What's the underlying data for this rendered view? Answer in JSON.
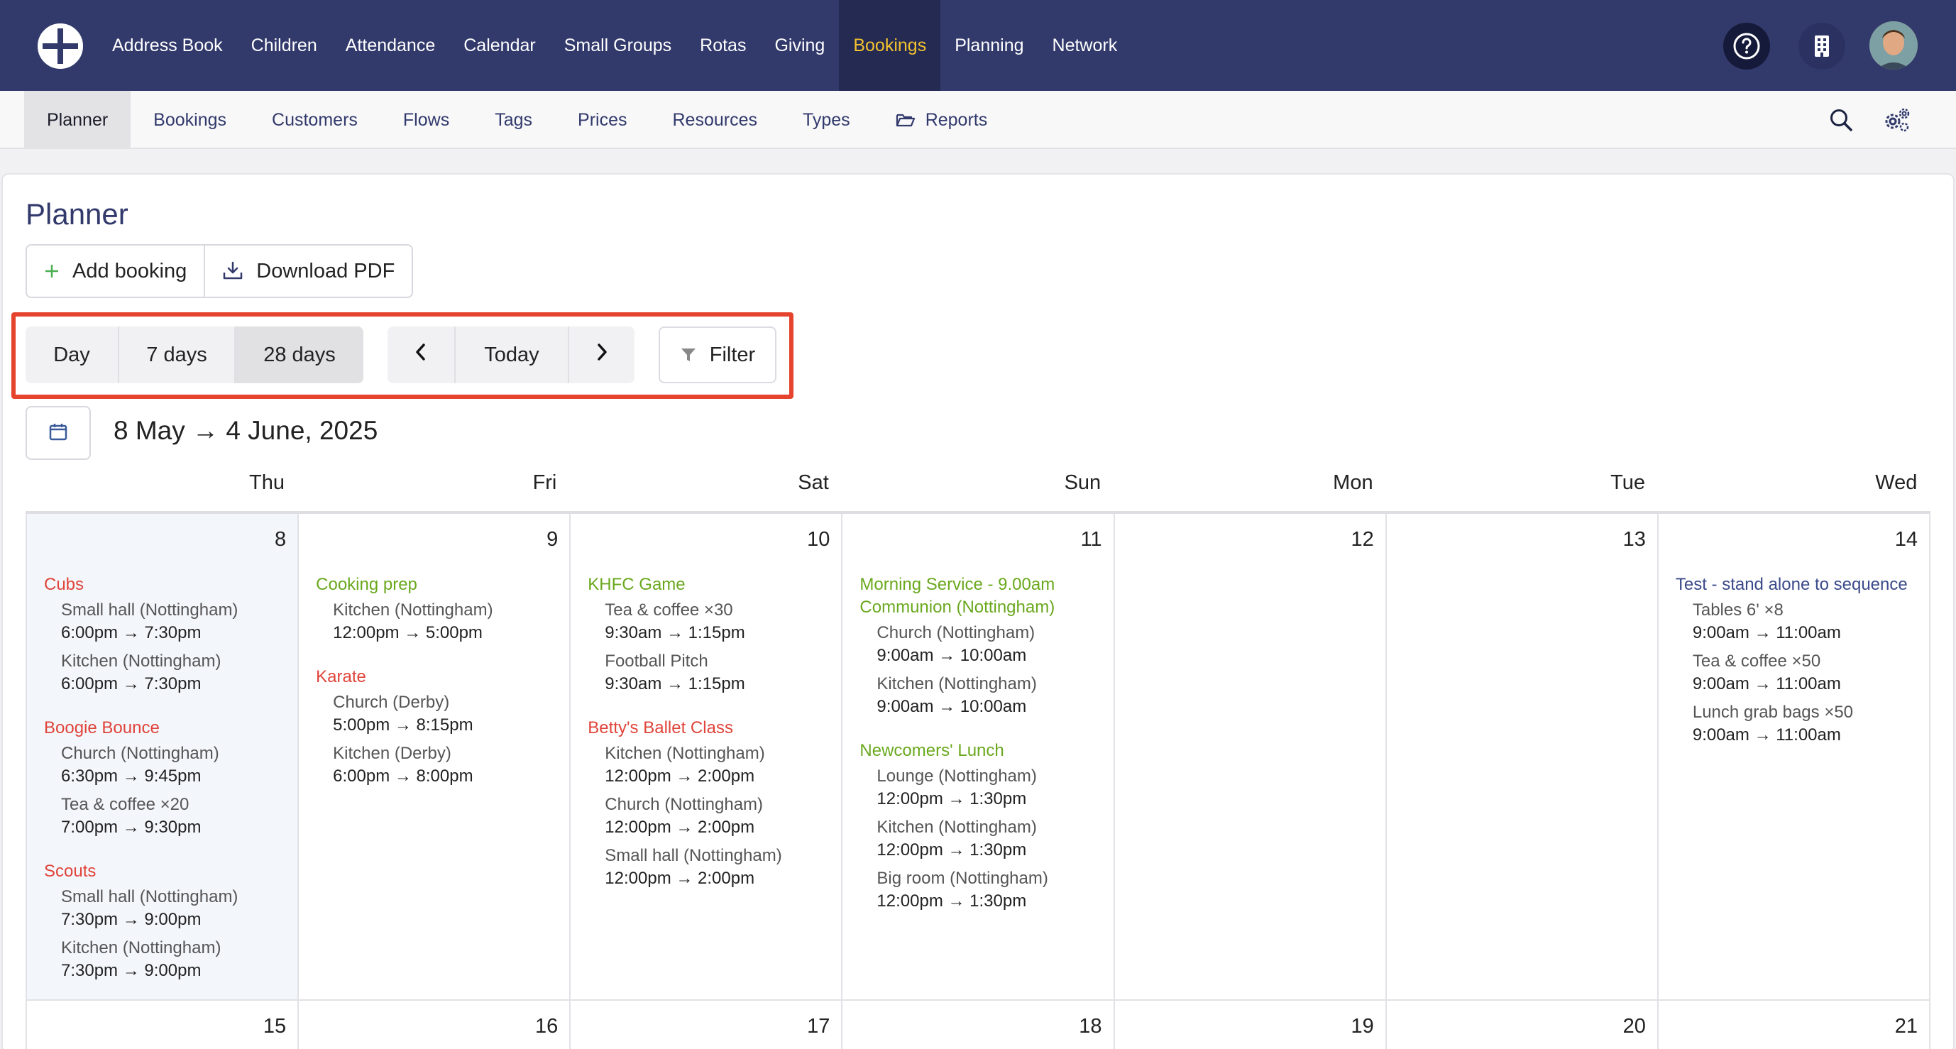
{
  "topnav": {
    "items": [
      "Address Book",
      "Children",
      "Attendance",
      "Calendar",
      "Small Groups",
      "Rotas",
      "Giving",
      "Bookings",
      "Planning",
      "Network"
    ],
    "active": "Bookings"
  },
  "subnav": {
    "items": [
      "Planner",
      "Bookings",
      "Customers",
      "Flows",
      "Tags",
      "Prices",
      "Resources",
      "Types",
      "Reports"
    ],
    "active": "Planner"
  },
  "page": {
    "title": "Planner",
    "add_booking": "Add booking",
    "download_pdf": "Download PDF"
  },
  "view_toggle": {
    "day": "Day",
    "seven": "7 days",
    "twenty_eight": "28 days",
    "active": "28 days"
  },
  "nav": {
    "prev": "‹",
    "today": "Today",
    "next": "›"
  },
  "filter": "Filter",
  "range": "8 May → 4 June, 2025",
  "weekdays": [
    "Thu",
    "Fri",
    "Sat",
    "Sun",
    "Mon",
    "Tue",
    "Wed"
  ],
  "week1": [
    {
      "num": "8",
      "events": [
        {
          "title": "Cubs",
          "color": "red",
          "resources": [
            {
              "name": "Small hall (Nottingham)",
              "time": "6:00pm → 7:30pm"
            },
            {
              "name": "Kitchen (Nottingham)",
              "time": "6:00pm → 7:30pm"
            }
          ]
        },
        {
          "title": "Boogie Bounce",
          "color": "red",
          "resources": [
            {
              "name": "Church (Nottingham)",
              "time": "6:30pm → 9:45pm"
            },
            {
              "name": "Tea & coffee ×20",
              "time": "7:00pm → 9:30pm"
            }
          ]
        },
        {
          "title": "Scouts",
          "color": "red",
          "resources": [
            {
              "name": "Small hall (Nottingham)",
              "time": "7:30pm → 9:00pm"
            },
            {
              "name": "Kitchen (Nottingham)",
              "time": "7:30pm → 9:00pm"
            }
          ]
        }
      ]
    },
    {
      "num": "9",
      "events": [
        {
          "title": "Cooking prep",
          "color": "green",
          "resources": [
            {
              "name": "Kitchen (Nottingham)",
              "time": "12:00pm → 5:00pm"
            }
          ]
        },
        {
          "title": "Karate",
          "color": "red",
          "resources": [
            {
              "name": "Church (Derby)",
              "time": "5:00pm → 8:15pm"
            },
            {
              "name": "Kitchen (Derby)",
              "time": "6:00pm → 8:00pm"
            }
          ]
        }
      ]
    },
    {
      "num": "10",
      "events": [
        {
          "title": "KHFC Game",
          "color": "green",
          "resources": [
            {
              "name": "Tea & coffee ×30",
              "time": "9:30am → 1:15pm"
            },
            {
              "name": "Football Pitch",
              "time": "9:30am → 1:15pm"
            }
          ]
        },
        {
          "title": "Betty's Ballet Class",
          "color": "red",
          "resources": [
            {
              "name": "Kitchen (Nottingham)",
              "time": "12:00pm → 2:00pm"
            },
            {
              "name": "Church (Nottingham)",
              "time": "12:00pm → 2:00pm"
            },
            {
              "name": "Small hall (Nottingham)",
              "time": "12:00pm → 2:00pm"
            }
          ]
        }
      ]
    },
    {
      "num": "11",
      "events": [
        {
          "title": "Morning Service - 9.00am Communion (Nottingham)",
          "color": "green",
          "resources": [
            {
              "name": "Church (Nottingham)",
              "time": "9:00am → 10:00am"
            },
            {
              "name": "Kitchen (Nottingham)",
              "time": "9:00am → 10:00am"
            }
          ]
        },
        {
          "title": "Newcomers' Lunch",
          "color": "green",
          "resources": [
            {
              "name": "Lounge (Nottingham)",
              "time": "12:00pm → 1:30pm"
            },
            {
              "name": "Kitchen (Nottingham)",
              "time": "12:00pm → 1:30pm"
            },
            {
              "name": "Big room (Nottingham)",
              "time": "12:00pm → 1:30pm"
            }
          ]
        }
      ]
    },
    {
      "num": "12",
      "events": []
    },
    {
      "num": "13",
      "events": []
    },
    {
      "num": "14",
      "events": [
        {
          "title": "Test - stand alone to sequence",
          "color": "blue",
          "resources": [
            {
              "name": "Tables 6' ×8",
              "time": "9:00am → 11:00am"
            },
            {
              "name": "Tea & coffee ×50",
              "time": "9:00am → 11:00am"
            },
            {
              "name": "Lunch grab bags ×50",
              "time": "9:00am → 11:00am"
            }
          ]
        }
      ]
    }
  ],
  "week2": [
    "15",
    "16",
    "17",
    "18",
    "19",
    "20",
    "21"
  ]
}
